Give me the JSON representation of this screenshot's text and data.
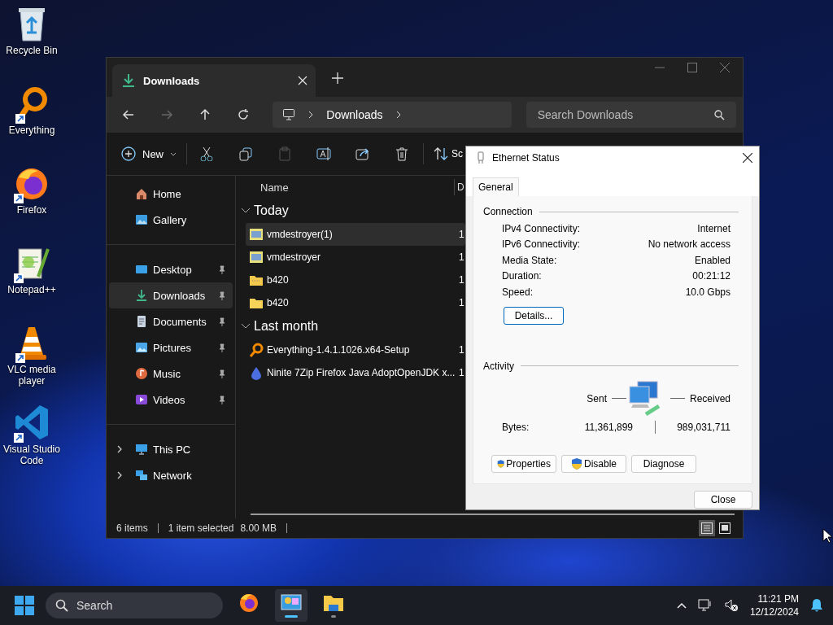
{
  "desktop_icons": [
    {
      "label": "Recycle Bin",
      "kind": "recycle",
      "shortcut": false
    },
    {
      "label": "Everything",
      "kind": "everything",
      "shortcut": true
    },
    {
      "label": "Firefox",
      "kind": "firefox",
      "shortcut": true
    },
    {
      "label": "Notepad++",
      "kind": "notepad",
      "shortcut": true
    },
    {
      "label": "VLC media player",
      "kind": "vlc",
      "shortcut": true
    },
    {
      "label": "Visual Studio Code",
      "kind": "vscode",
      "shortcut": true
    }
  ],
  "explorer": {
    "tabs": [
      {
        "title": "Downloads",
        "selected": true
      }
    ],
    "address": {
      "segments": [
        "Downloads"
      ]
    },
    "search": {
      "placeholder": "Search Downloads"
    },
    "toolbar": {
      "new_label": "New",
      "sort_label": "Sc"
    },
    "sidebar": {
      "groups": [
        {
          "items": [
            {
              "label": "Home",
              "kind": "home",
              "selected": false
            },
            {
              "label": "Gallery",
              "kind": "gallery",
              "selected": false
            }
          ]
        },
        {
          "items": [
            {
              "label": "Desktop",
              "kind": "desktop",
              "pinned": true,
              "selected": false
            },
            {
              "label": "Downloads",
              "kind": "downloads",
              "pinned": true,
              "selected": true
            },
            {
              "label": "Documents",
              "kind": "documents",
              "pinned": true,
              "selected": false
            },
            {
              "label": "Pictures",
              "kind": "pictures",
              "pinned": true,
              "selected": false
            },
            {
              "label": "Music",
              "kind": "music",
              "pinned": true,
              "selected": false
            },
            {
              "label": "Videos",
              "kind": "videos",
              "pinned": true,
              "selected": false
            }
          ]
        },
        {
          "items": [
            {
              "label": "This PC",
              "kind": "pc",
              "expanded": false,
              "selected": false
            },
            {
              "label": "Network",
              "kind": "network",
              "expanded": false,
              "selected": false
            }
          ]
        }
      ]
    },
    "columns": [
      "Name",
      "D"
    ],
    "groups": [
      {
        "label": "Today",
        "expanded": true,
        "files": [
          {
            "name": "vmdestroyer(1)",
            "kind": "app",
            "column_2": "1",
            "selected": true
          },
          {
            "name": "vmdestroyer",
            "kind": "app",
            "column_2": "1",
            "selected": false
          },
          {
            "name": "b420",
            "kind": "zipfolder",
            "column_2": "1",
            "selected": false
          },
          {
            "name": "b420",
            "kind": "folder",
            "column_2": "1",
            "selected": false
          }
        ]
      },
      {
        "label": "Last month",
        "expanded": true,
        "files": [
          {
            "name": "Everything-1.4.1.1026.x64-Setup",
            "kind": "everything",
            "column_2": "1",
            "selected": false
          },
          {
            "name": "Ninite 7Zip Firefox Java AdoptOpenJDK x...",
            "kind": "ninite",
            "column_2": "1",
            "selected": false
          }
        ]
      }
    ],
    "status": {
      "count": "6 items",
      "selection": "1 item selected",
      "size": "8.00 MB"
    },
    "views": [
      {
        "kind": "details",
        "selected": true
      },
      {
        "kind": "tiles",
        "selected": false
      }
    ]
  },
  "dialog": {
    "title": "Ethernet Status",
    "tabs": [
      {
        "label": "General",
        "selected": true
      }
    ],
    "connection_label": "Connection",
    "rows": [
      {
        "label": "IPv4 Connectivity:",
        "value": "Internet"
      },
      {
        "label": "IPv6 Connectivity:",
        "value": "No network access"
      },
      {
        "label": "Media State:",
        "value": "Enabled"
      },
      {
        "label": "Duration:",
        "value": "00:21:12"
      },
      {
        "label": "Speed:",
        "value": "10.0 Gbps"
      }
    ],
    "details_button": "Details...",
    "activity_label": "Activity",
    "sent_label": "Sent",
    "received_label": "Received",
    "bytes_label": "Bytes:",
    "bytes_sent": "11,361,899",
    "bytes_received": "989,031,711",
    "buttons": [
      {
        "label": "Properties",
        "shield": true
      },
      {
        "label": "Disable",
        "shield": true
      },
      {
        "label": "Diagnose",
        "shield": false
      }
    ],
    "close_button": "Close"
  },
  "taskbar": {
    "search": {
      "placeholder": "Search"
    },
    "apps": [
      {
        "kind": "firefox",
        "active": false,
        "running": false
      },
      {
        "kind": "network",
        "active": true,
        "running": true
      },
      {
        "kind": "explorer",
        "active": false,
        "running": true
      }
    ],
    "time": "11:21 PM",
    "date": "12/12/2024"
  }
}
